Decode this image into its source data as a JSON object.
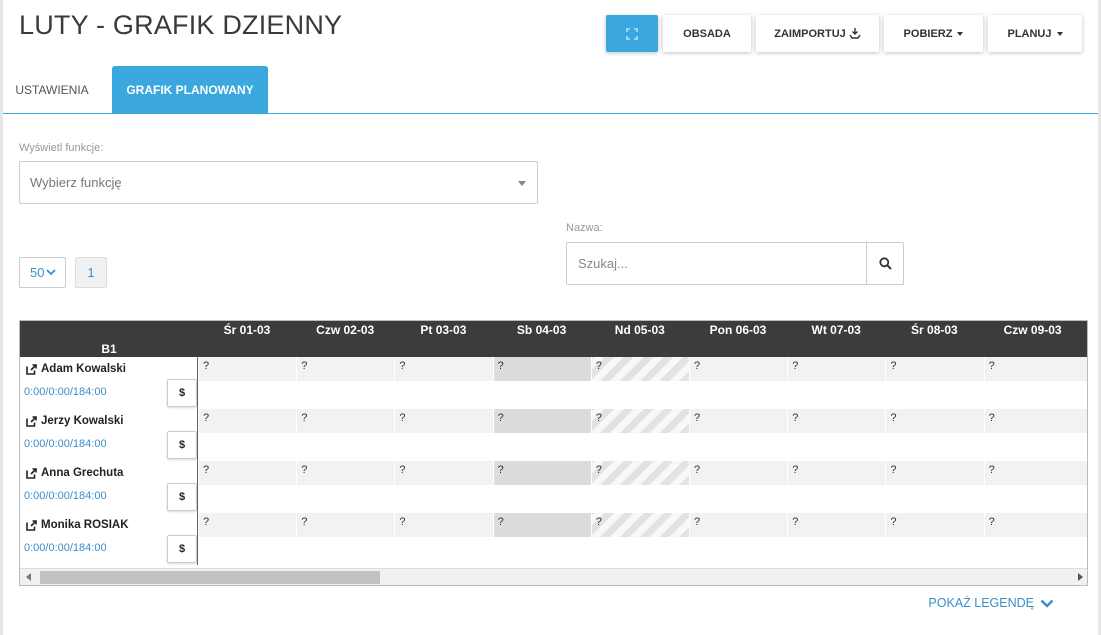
{
  "header": {
    "title": "LUTY - GRAFIK DZIENNY"
  },
  "toolbar": {
    "fullscreen_icon": "expand-icon",
    "obsada": "OBSADA",
    "zaimportuj": "ZAIMPORTUJ",
    "pobierz": "POBIERZ",
    "planuj": "PLANUJ",
    "accent": "#3aa8df"
  },
  "tabs": [
    {
      "label": "USTAWIENIA",
      "active": false
    },
    {
      "label": "GRAFIK PLANOWANY",
      "active": true
    }
  ],
  "filters": {
    "func_label": "Wyświetl funkcje:",
    "func_placeholder": "Wybierz funkcję",
    "name_label": "Nazwa:",
    "search_placeholder": "Szukaj..."
  },
  "pagination": {
    "per_page": "50",
    "page": "1"
  },
  "grid": {
    "group": "B1",
    "days": [
      "Śr 01-03",
      "Czw 02-03",
      "Pt 03-03",
      "Sb 04-03",
      "Nd 05-03",
      "Pon 06-03",
      "Wt 07-03",
      "Śr 08-03",
      "Czw 09-03"
    ],
    "employees": [
      {
        "name": "Adam Kowalski",
        "hours": "0:00/0:00/184:00",
        "dollar": "$",
        "cells": [
          "?",
          "?",
          "?",
          "?",
          "?",
          "?",
          "?",
          "?",
          "?"
        ]
      },
      {
        "name": "Jerzy Kowalski",
        "hours": "0:00/0:00/184:00",
        "dollar": "$",
        "cells": [
          "?",
          "?",
          "?",
          "?",
          "?",
          "?",
          "?",
          "?",
          "?"
        ]
      },
      {
        "name": "Anna Grechuta",
        "hours": "0:00/0:00/184:00",
        "dollar": "$",
        "cells": [
          "?",
          "?",
          "?",
          "?",
          "?",
          "?",
          "?",
          "?",
          "?"
        ]
      },
      {
        "name": "Monika ROSIAK",
        "hours": "0:00/0:00/184:00",
        "dollar": "$",
        "cells": [
          "?",
          "?",
          "?",
          "?",
          "?",
          "?",
          "?",
          "?",
          "?"
        ]
      }
    ]
  },
  "legend": {
    "label": "POKAŻ LEGENDĘ"
  }
}
